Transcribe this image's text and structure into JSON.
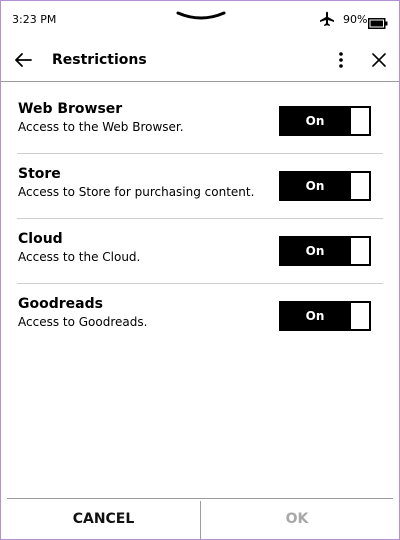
{
  "status_bar": {
    "time": "3:23 PM",
    "battery_percent": "90%",
    "icons": [
      "pull-down-handle",
      "airplane-mode-icon",
      "battery-icon"
    ]
  },
  "header": {
    "title": "Restrictions",
    "icons": [
      "back-arrow-icon",
      "more-vertical-icon",
      "close-icon"
    ]
  },
  "restrictions": [
    {
      "title": "Web Browser",
      "description": "Access to the Web Browser.",
      "toggle_label": "On"
    },
    {
      "title": "Store",
      "description": "Access to Store for purchasing content.",
      "toggle_label": "On"
    },
    {
      "title": "Cloud",
      "description": "Access to the Cloud.",
      "toggle_label": "On"
    },
    {
      "title": "Goodreads",
      "description": "Access to Goodreads.",
      "toggle_label": "On"
    }
  ],
  "footer": {
    "cancel_label": "CANCEL",
    "ok_label": "OK"
  },
  "colors": {
    "accent": "#000000",
    "disabled_text": "#a8a8a8",
    "divider": "#cfcfcf",
    "frame": "#b48fd1"
  }
}
